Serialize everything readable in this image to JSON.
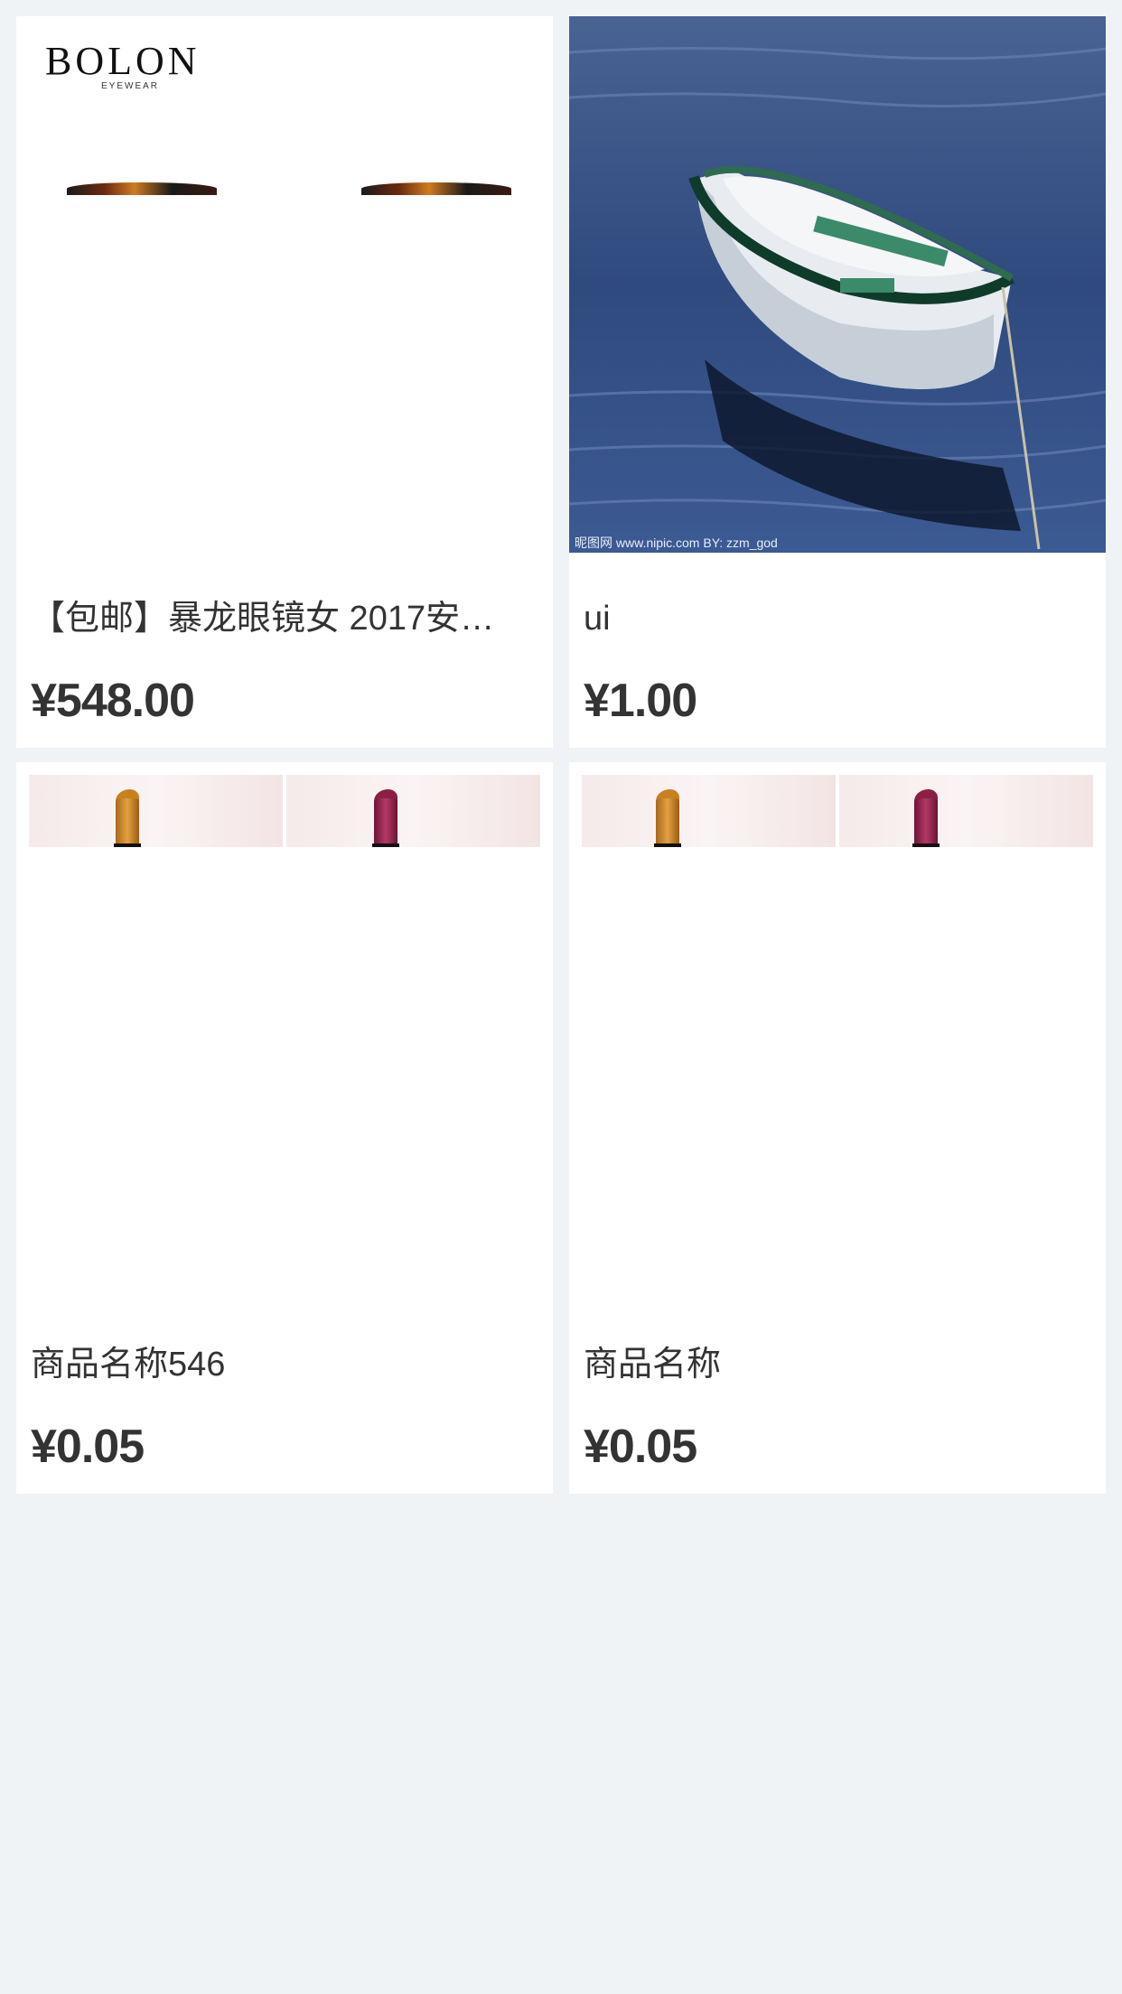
{
  "products": [
    {
      "title": "【包邮】暴龙眼镜女 2017安…",
      "price": "¥548.00",
      "image": "bolon-sunglasses"
    },
    {
      "title": "ui",
      "price": "¥1.00",
      "image": "rowboat-photo"
    },
    {
      "title": "商品名称546",
      "price": "¥0.05",
      "image": "lipstick-photo"
    },
    {
      "title": "商品名称",
      "price": "¥0.05",
      "image": "lipstick-photo"
    }
  ],
  "brand": {
    "logo": "BOLON",
    "sub": "EYEWEAR"
  },
  "photo_watermark": {
    "left": "昵图网 www.nipic.com   BY: zzm_god"
  },
  "colors": {
    "background": "#f0f3f6",
    "card": "#ffffff",
    "text": "#333333"
  }
}
